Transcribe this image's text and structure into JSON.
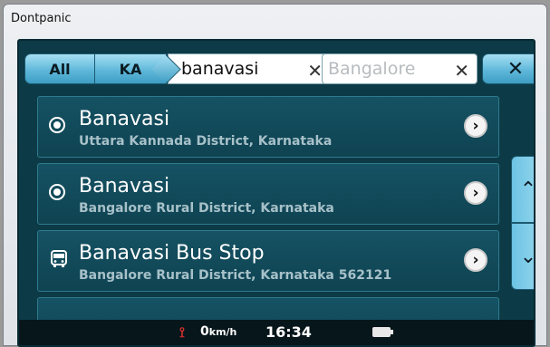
{
  "window": {
    "title": "Dontpanic"
  },
  "search": {
    "scope_all_label": "All",
    "scope_state_label": "KA",
    "city_value": "banavasi",
    "state_placeholder": "Bangalore",
    "clear_glyph": "✕",
    "close_glyph": "✕"
  },
  "results": [
    {
      "icon": "location-radio-icon",
      "title": "Banavasi",
      "subtitle": "Uttara Kannada District, Karnataka"
    },
    {
      "icon": "location-radio-icon",
      "title": "Banavasi",
      "subtitle": "Bangalore Rural District, Karnataka"
    },
    {
      "icon": "bus-icon",
      "title": "Banavasi Bus Stop",
      "subtitle": "Bangalore Rural District, Karnataka 562121"
    }
  ],
  "scroll": {
    "up_glyph": "⌃",
    "down_glyph": "⌄"
  },
  "status": {
    "speed_value": "0",
    "speed_unit": "km/h",
    "time": "16:34"
  },
  "colors": {
    "accent": "#5fb8da",
    "background": "#0c3a46",
    "row": "#155263",
    "speed_icon": "#e0322c"
  }
}
